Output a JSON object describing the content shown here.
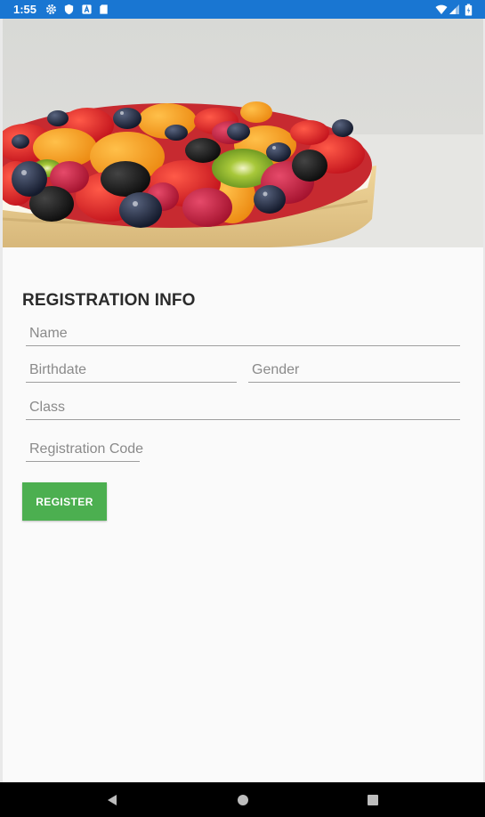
{
  "status_bar": {
    "time": "1:55",
    "background": "#1976d2",
    "left_icons": [
      "gear-icon",
      "shield-icon",
      "a-badge-icon",
      "sd-card-icon"
    ],
    "right_icons": [
      "wifi-icon",
      "signal-icon",
      "battery-icon"
    ]
  },
  "hero": {
    "image": "fruit-tart-photo"
  },
  "form": {
    "title": "REGISTRATION INFO",
    "fields": {
      "name": {
        "placeholder": "Name",
        "value": ""
      },
      "birthdate": {
        "placeholder": "Birthdate",
        "value": ""
      },
      "gender": {
        "placeholder": "Gender",
        "value": ""
      },
      "class": {
        "placeholder": "Class",
        "value": ""
      },
      "registration_code": {
        "placeholder": "Registration Code",
        "value": ""
      }
    },
    "register_button": {
      "label": "REGISTER",
      "color": "#4caf50"
    }
  },
  "nav_bar": {
    "buttons": [
      "back-icon",
      "home-icon",
      "recents-icon"
    ]
  }
}
